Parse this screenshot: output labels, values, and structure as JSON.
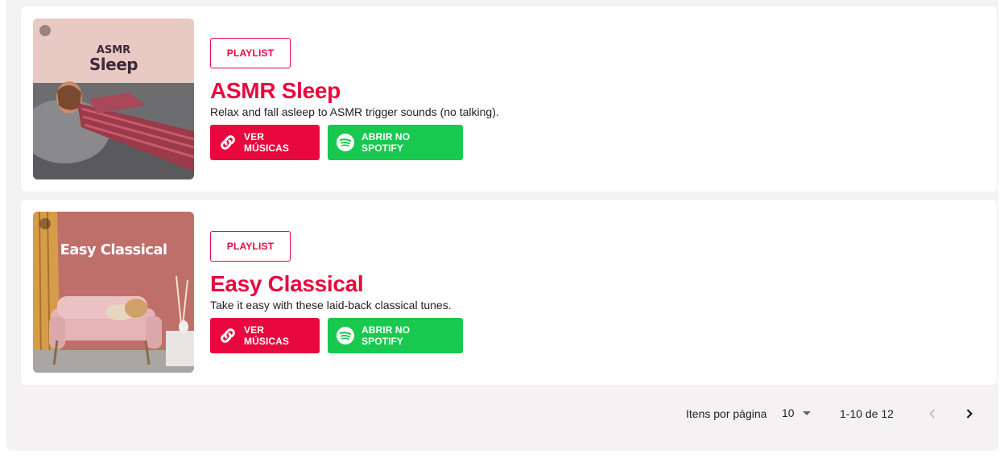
{
  "colors": {
    "accent": "#e8083e",
    "spotify_green": "#19c94f"
  },
  "playlists": [
    {
      "cover_line1": "ASMR",
      "cover_line2": "Sleep",
      "badge": "PLAYLIST",
      "title": "ASMR Sleep",
      "description": "Relax and fall asleep to ASMR trigger sounds (no talking).",
      "btn_songs": "VER MÚSICAS",
      "btn_spotify": "ABRIR NO SPOTIFY"
    },
    {
      "cover_line1": "Easy Classical",
      "badge": "PLAYLIST",
      "title": "Easy Classical",
      "description": "Take it easy with these laid-back classical tunes.",
      "btn_songs": "VER MÚSICAS",
      "btn_spotify": "ABRIR NO SPOTIFY"
    }
  ],
  "paginator": {
    "items_per_page_label": "Itens por página",
    "items_per_page_value": "10",
    "range_label": "1-10 de 12",
    "prev_icon": "chevron-left-icon",
    "next_icon": "chevron-right-icon"
  }
}
